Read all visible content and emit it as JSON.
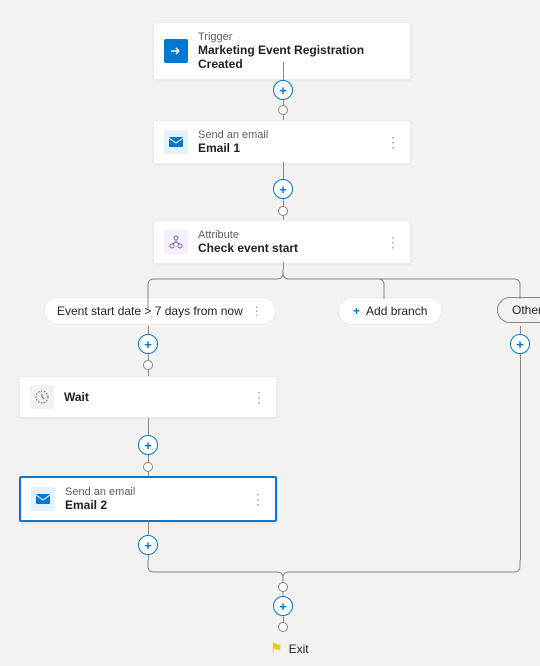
{
  "trigger": {
    "label": "Trigger",
    "title": "Marketing Event Registration Created"
  },
  "email1": {
    "label": "Send an email",
    "title": "Email 1"
  },
  "attribute": {
    "label": "Attribute",
    "title": "Check event start"
  },
  "branch_condition": {
    "text": "Event start date > 7 days from now"
  },
  "add_branch": {
    "label": "Add branch"
  },
  "other_branch": {
    "label": "Other"
  },
  "wait": {
    "title": "Wait"
  },
  "email2": {
    "label": "Send an email",
    "title": "Email 2"
  },
  "exit": {
    "label": "Exit"
  }
}
